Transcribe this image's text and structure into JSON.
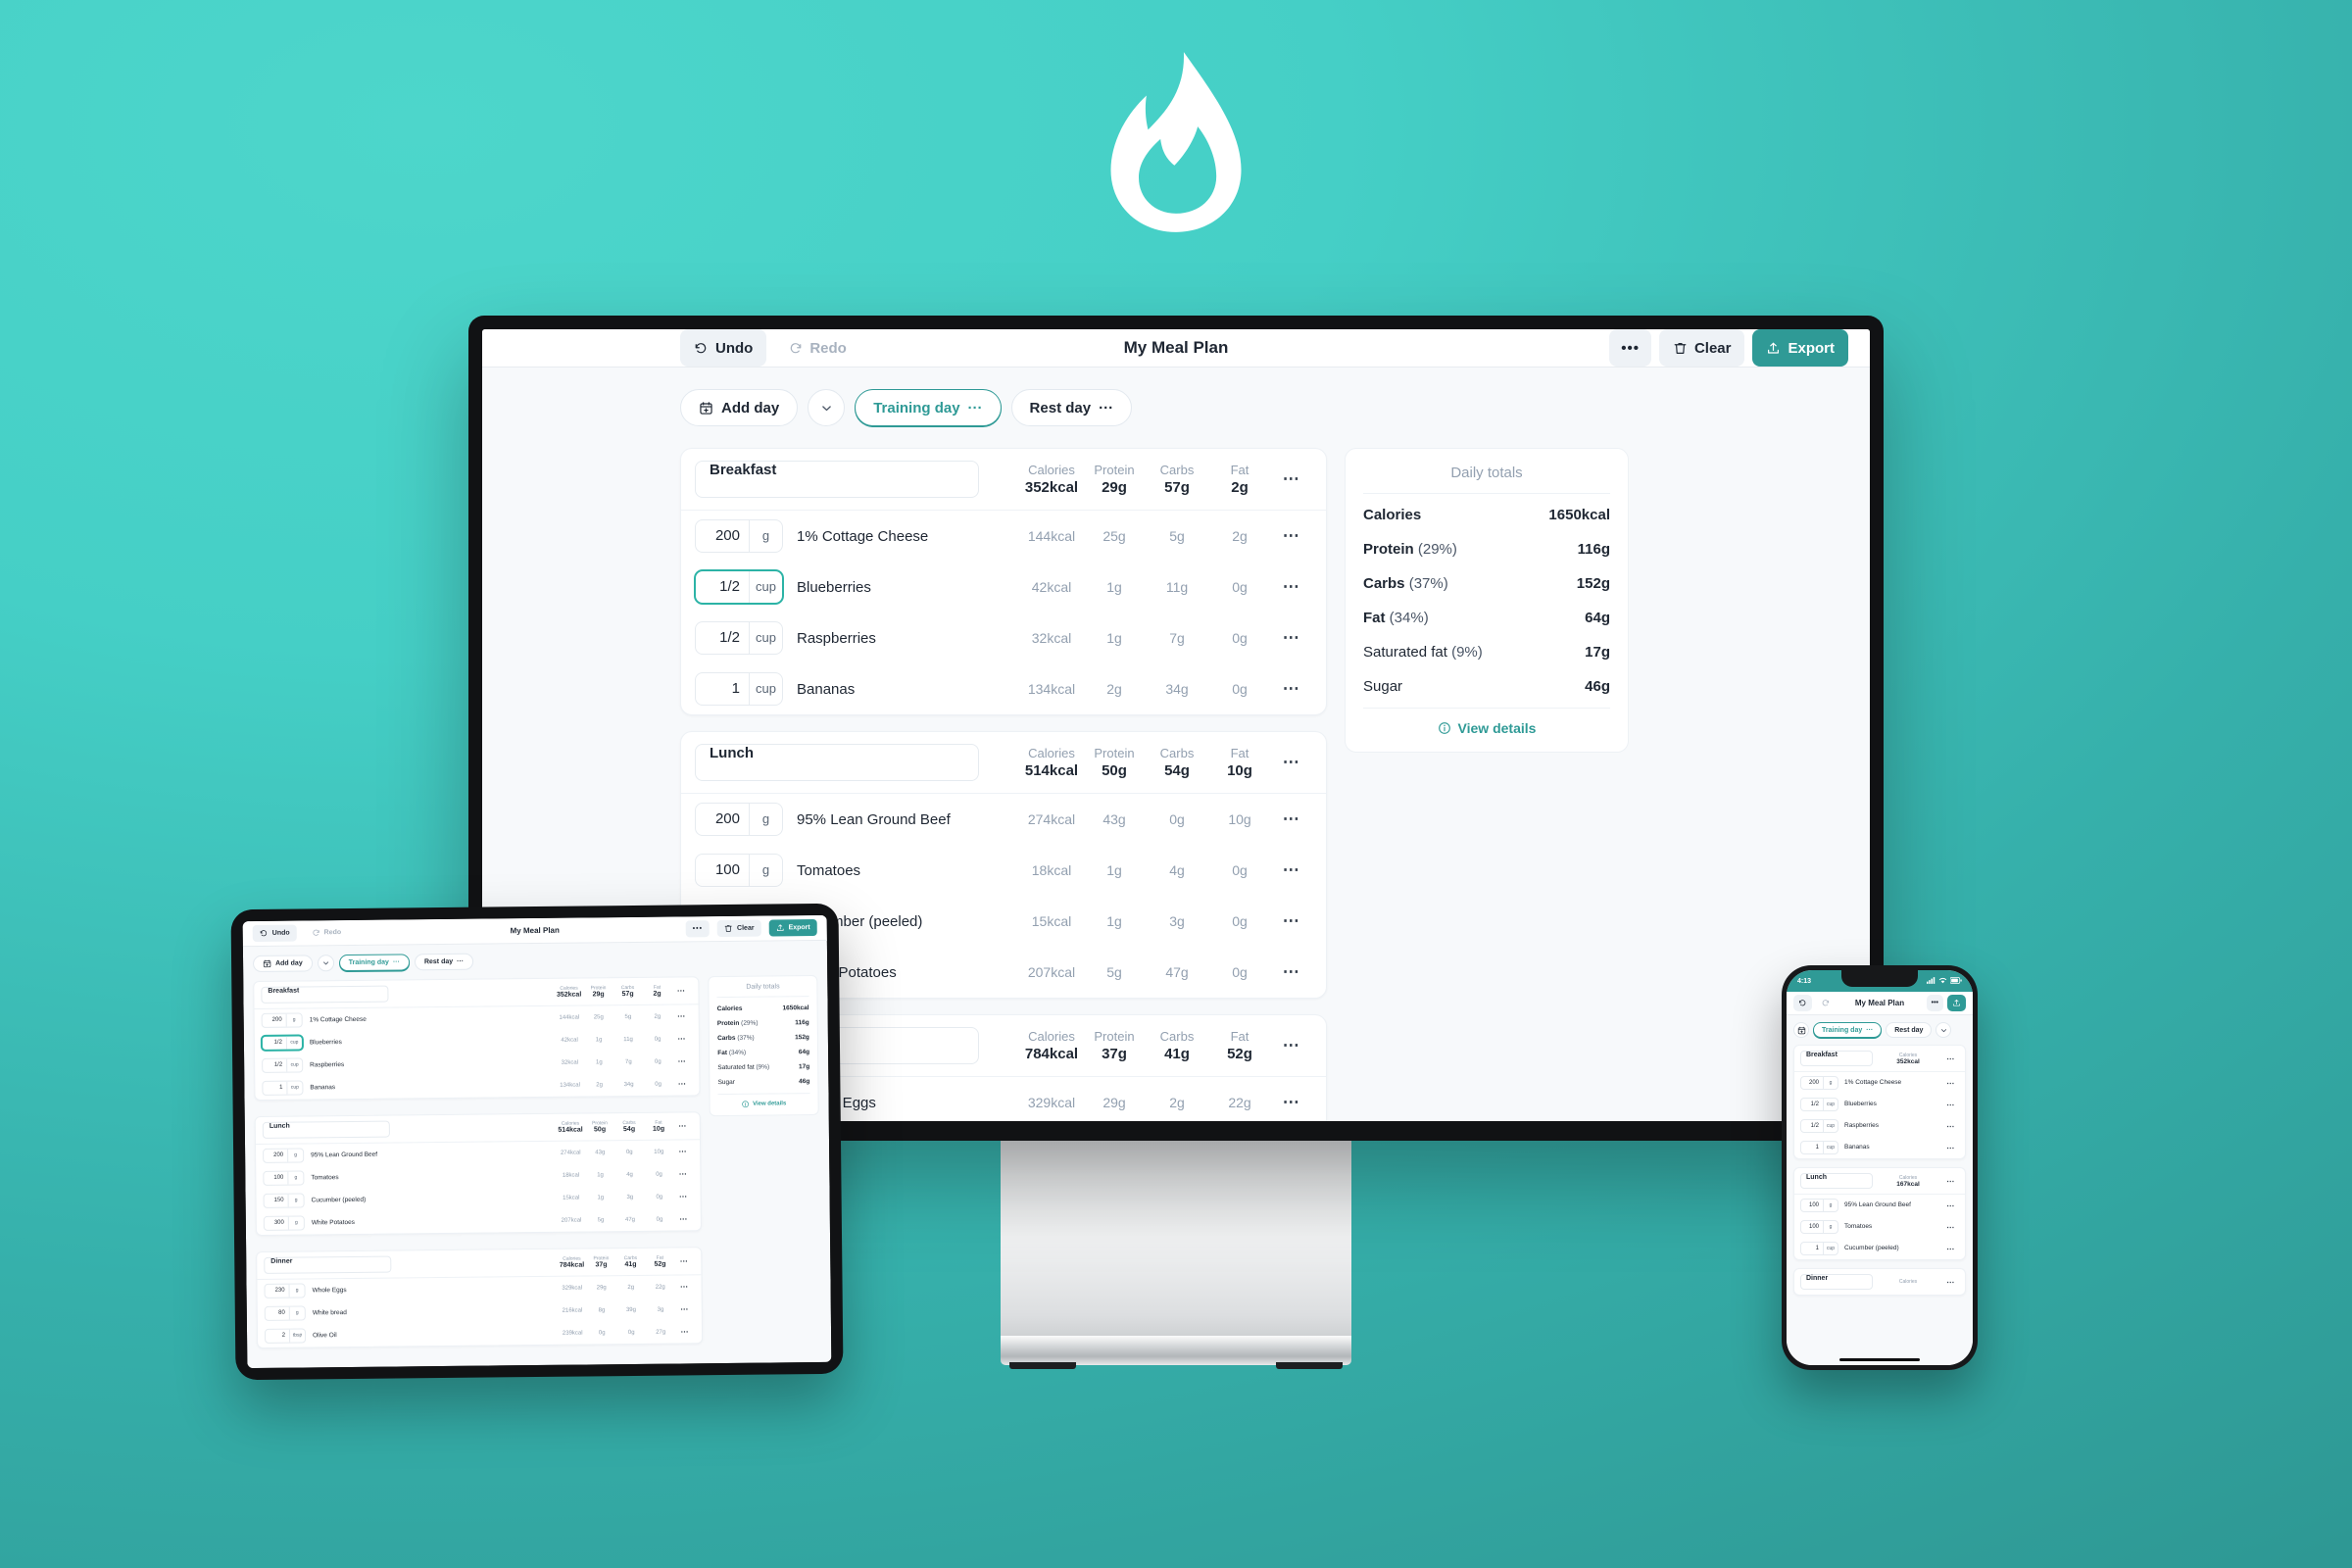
{
  "brand": {
    "logo": "flame-icon",
    "logo_color": "#ffffff"
  },
  "background": {
    "top_color": "#4dd6cb",
    "bottom_color": "#2d9591"
  },
  "theme": {
    "accent": "#2f9a96",
    "accent_light": "#2cb3a6",
    "muted": "#93a0b0",
    "text": "#1f2733"
  },
  "app": {
    "title": "My Meal Plan",
    "toolbar": {
      "undo": "Undo",
      "redo": "Redo",
      "more": "•••",
      "clear": "Clear",
      "export": "Export",
      "icons": {
        "undo": "undo-arrow-icon",
        "redo": "redo-arrow-icon",
        "clear": "trash-icon",
        "export": "upload-icon"
      }
    },
    "daybar": {
      "add_day": "Add day",
      "add_day_icon": "calendar-plus-icon",
      "chevron": "chevron-down-icon",
      "days": [
        {
          "label": "Training day",
          "dots": "···",
          "active": true
        },
        {
          "label": "Rest day",
          "dots": "···",
          "active": false
        }
      ]
    },
    "macro_headers": [
      "Calories",
      "Protein",
      "Carbs",
      "Fat"
    ],
    "meals": [
      {
        "name": "Breakfast",
        "totals": {
          "calories": "352kcal",
          "protein": "29g",
          "carbs": "57g",
          "fat": "2g"
        },
        "items": [
          {
            "qty": "200",
            "unit": "g",
            "name": "1% Cottage Cheese",
            "calories": "144kcal",
            "protein": "25g",
            "carbs": "5g",
            "fat": "2g",
            "focused": false
          },
          {
            "qty": "1/2",
            "unit": "cup",
            "name": "Blueberries",
            "calories": "42kcal",
            "protein": "1g",
            "carbs": "11g",
            "fat": "0g",
            "focused": true
          },
          {
            "qty": "1/2",
            "unit": "cup",
            "name": "Raspberries",
            "calories": "32kcal",
            "protein": "1g",
            "carbs": "7g",
            "fat": "0g",
            "focused": false
          },
          {
            "qty": "1",
            "unit": "cup",
            "name": "Bananas",
            "calories": "134kcal",
            "protein": "2g",
            "carbs": "34g",
            "fat": "0g",
            "focused": false
          }
        ]
      },
      {
        "name": "Lunch",
        "totals": {
          "calories": "514kcal",
          "protein": "50g",
          "carbs": "54g",
          "fat": "10g"
        },
        "items": [
          {
            "qty": "200",
            "unit": "g",
            "name": "95% Lean Ground Beef",
            "calories": "274kcal",
            "protein": "43g",
            "carbs": "0g",
            "fat": "10g",
            "focused": false
          },
          {
            "qty": "100",
            "unit": "g",
            "name": "Tomatoes",
            "calories": "18kcal",
            "protein": "1g",
            "carbs": "4g",
            "fat": "0g",
            "focused": false
          },
          {
            "qty": "150",
            "unit": "g",
            "name": "Cucumber (peeled)",
            "calories": "15kcal",
            "protein": "1g",
            "carbs": "3g",
            "fat": "0g",
            "focused": false
          },
          {
            "qty": "300",
            "unit": "g",
            "name": "White Potatoes",
            "calories": "207kcal",
            "protein": "5g",
            "carbs": "47g",
            "fat": "0g",
            "focused": false
          }
        ]
      },
      {
        "name": "Dinner",
        "totals": {
          "calories": "784kcal",
          "protein": "37g",
          "carbs": "41g",
          "fat": "52g"
        },
        "items": [
          {
            "qty": "230",
            "unit": "g",
            "name": "Whole Eggs",
            "calories": "329kcal",
            "protein": "29g",
            "carbs": "2g",
            "fat": "22g",
            "focused": false
          },
          {
            "qty": "80",
            "unit": "g",
            "name": "White bread",
            "calories": "216kcal",
            "protein": "8g",
            "carbs": "39g",
            "fat": "3g",
            "focused": false
          },
          {
            "qty": "2",
            "unit": "tbsp",
            "name": "Olive Oil",
            "calories": "239kcal",
            "protein": "0g",
            "carbs": "0g",
            "fat": "27g",
            "focused": false
          }
        ]
      }
    ],
    "daily_totals": {
      "heading": "Daily totals",
      "rows": [
        {
          "label": "Calories",
          "pct": "",
          "value": "1650kcal",
          "bold": true
        },
        {
          "label": "Protein",
          "pct": "(29%)",
          "value": "116g",
          "bold": true
        },
        {
          "label": "Carbs",
          "pct": "(37%)",
          "value": "152g",
          "bold": true
        },
        {
          "label": "Fat",
          "pct": "(34%)",
          "value": "64g",
          "bold": true
        },
        {
          "label": "Saturated fat",
          "pct": "(9%)",
          "value": "17g",
          "bold": false
        },
        {
          "label": "Sugar",
          "pct": "",
          "value": "46g",
          "bold": false
        }
      ],
      "view_details": "View details",
      "view_details_icon": "info-circle-icon"
    }
  },
  "phone": {
    "status": {
      "time": "4:13",
      "signal": "signal-icon",
      "wifi": "wifi-icon",
      "battery": "battery-icon"
    },
    "meals": [
      {
        "name": "Breakfast",
        "calories_label": "Calories",
        "calories": "352kcal",
        "items": [
          {
            "qty": "200",
            "unit": "g",
            "name": "1% Cottage Cheese"
          },
          {
            "qty": "1/2",
            "unit": "cup",
            "name": "Blueberries"
          },
          {
            "qty": "1/2",
            "unit": "cup",
            "name": "Raspberries"
          },
          {
            "qty": "1",
            "unit": "cup",
            "name": "Bananas"
          }
        ]
      },
      {
        "name": "Lunch",
        "calories_label": "Calories",
        "calories": "167kcal",
        "items": [
          {
            "qty": "100",
            "unit": "g",
            "name": "95% Lean Ground Beef"
          },
          {
            "qty": "100",
            "unit": "g",
            "name": "Tomatoes"
          },
          {
            "qty": "1",
            "unit": "cup",
            "name": "Cucumber (peeled)"
          }
        ]
      },
      {
        "name": "Dinner",
        "calories_label": "Calories",
        "calories": "",
        "items": []
      }
    ]
  }
}
